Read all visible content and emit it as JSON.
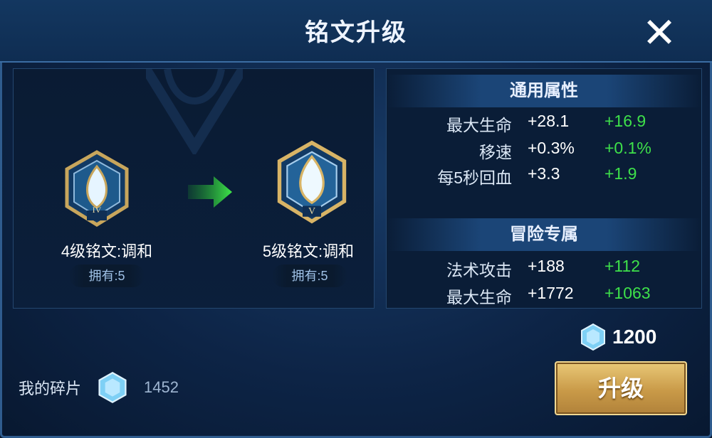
{
  "title": "铭文升级",
  "close_icon": "close-icon",
  "current_rune": {
    "name": "4级铭文:调和",
    "roman": "IV",
    "owned": "拥有:5"
  },
  "next_rune": {
    "name": "5级铭文:调和",
    "roman": "V",
    "owned": "拥有:5"
  },
  "arrow_icon": "green-arrow-icon",
  "general_attributes": {
    "title": "通用属性",
    "rows": [
      {
        "name": "最大生命",
        "current": "+28.1",
        "increase": "+16.9"
      },
      {
        "name": "移速",
        "current": "+0.3%",
        "increase": "+0.1%"
      },
      {
        "name": "每5秒回血",
        "current": "+3.3",
        "increase": "+1.9"
      }
    ]
  },
  "adventure_attributes": {
    "title": "冒险专属",
    "rows": [
      {
        "name": "法术攻击",
        "current": "+188",
        "increase": "+112"
      },
      {
        "name": "最大生命",
        "current": "+1772",
        "increase": "+1063"
      }
    ]
  },
  "cost": {
    "icon": "crystal-icon",
    "amount": "1200"
  },
  "shards": {
    "label": "我的碎片",
    "icon": "crystal-icon",
    "amount": "1452"
  },
  "upgrade_button": "升级",
  "colors": {
    "increase": "#3ee04a",
    "button_gold": "#c99a48",
    "panel": "#0a1d37"
  }
}
